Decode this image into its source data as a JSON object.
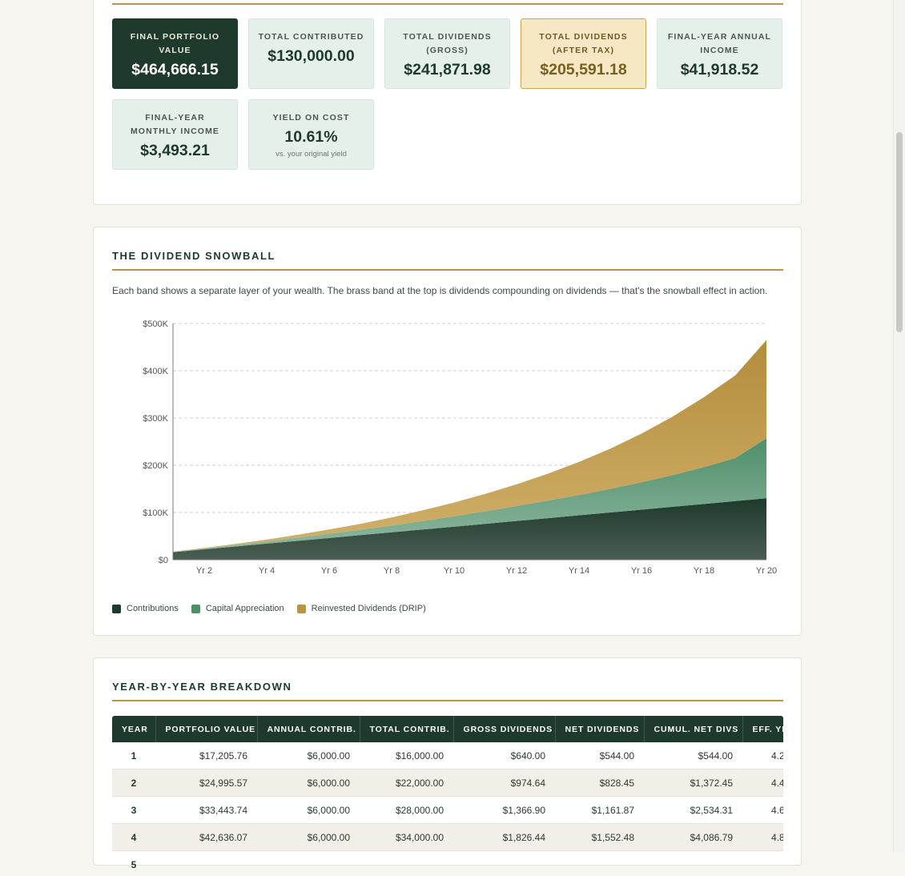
{
  "summary": {
    "final_value": {
      "label": "FINAL PORTFOLIO VALUE",
      "value": "$464,666.15"
    },
    "total_contributed": {
      "label": "TOTAL CONTRIBUTED",
      "value": "$130,000.00"
    },
    "total_div_gross": {
      "label": "TOTAL DIVIDENDS (GROSS)",
      "value": "$241,871.98"
    },
    "total_div_net": {
      "label": "TOTAL DIVIDENDS (AFTER TAX)",
      "value": "$205,591.18"
    },
    "final_annual_income": {
      "label": "FINAL-YEAR ANNUAL INCOME",
      "value": "$41,918.52"
    },
    "final_monthly_income": {
      "label": "FINAL-YEAR MONTHLY INCOME",
      "value": "$3,493.21"
    },
    "yield_on_cost": {
      "label": "YIELD ON COST",
      "value": "10.61%",
      "sub": "vs. your original yield"
    }
  },
  "snowball": {
    "title": "THE DIVIDEND SNOWBALL",
    "description": "Each band shows a separate layer of your wealth. The brass band at the top is dividends compounding on dividends — that's the snowball effect in action."
  },
  "chart_data": {
    "type": "area",
    "stacked": true,
    "x": [
      1,
      2,
      3,
      4,
      5,
      6,
      7,
      8,
      9,
      10,
      11,
      12,
      13,
      14,
      15,
      16,
      17,
      18,
      19,
      20
    ],
    "x_tick_labels": [
      "Yr 2",
      "Yr 4",
      "Yr 6",
      "Yr 8",
      "Yr 10",
      "Yr 12",
      "Yr 14",
      "Yr 16",
      "Yr 18",
      "Yr 20"
    ],
    "y_tick_labels": [
      "$0",
      "$100K",
      "$200K",
      "$300K",
      "$400K",
      "$500K"
    ],
    "ylim": [
      0,
      500000
    ],
    "grid": true,
    "legend_position": "bottom-left",
    "series": [
      {
        "name": "Contributions",
        "color": "#1d3a2c",
        "values": [
          16000,
          22000,
          28000,
          34000,
          40000,
          46000,
          52000,
          58000,
          64000,
          70000,
          76000,
          82000,
          88000,
          94000,
          100000,
          106000,
          112000,
          118000,
          124000,
          130000
        ]
      },
      {
        "name": "Capital Appreciation",
        "color": "#4e8f6a",
        "values": [
          600,
          1800,
          3200,
          4800,
          6800,
          9000,
          11500,
          14500,
          18000,
          22000,
          26500,
          31500,
          37000,
          43000,
          50000,
          58000,
          67000,
          78000,
          91000,
          127000
        ]
      },
      {
        "name": "Reinvested Dividends (DRIP)",
        "color": "#b99444",
        "values": [
          600,
          1200,
          2200,
          3800,
          6000,
          9000,
          12500,
          17000,
          22500,
          29000,
          37000,
          46000,
          57000,
          70000,
          85000,
          103000,
          124000,
          148000,
          175000,
          207666
        ]
      }
    ]
  },
  "breakdown": {
    "title": "YEAR-BY-YEAR BREAKDOWN",
    "columns": [
      "YEAR",
      "PORTFOLIO VALUE",
      "ANNUAL CONTRIB.",
      "TOTAL CONTRIB.",
      "GROSS DIVIDENDS",
      "NET DIVIDENDS",
      "CUMUL. NET DIVS",
      "EFF. YIELD"
    ],
    "rows": [
      [
        "1",
        "$17,205.76",
        "$6,000.00",
        "$16,000.00",
        "$640.00",
        "$544.00",
        "$544.00",
        "4.2"
      ],
      [
        "2",
        "$24,995.57",
        "$6,000.00",
        "$22,000.00",
        "$974.64",
        "$828.45",
        "$1,372.45",
        "4.4"
      ],
      [
        "3",
        "$33,443.74",
        "$6,000.00",
        "$28,000.00",
        "$1,366.90",
        "$1,161.87",
        "$2,534.31",
        "4.6"
      ],
      [
        "4",
        "$42,636.07",
        "$6,000.00",
        "$34,000.00",
        "$1,826.44",
        "$1,552.48",
        "$4,086.79",
        "4.8"
      ],
      [
        "5",
        "",
        "",
        "",
        "",
        "",
        "",
        ""
      ]
    ]
  }
}
